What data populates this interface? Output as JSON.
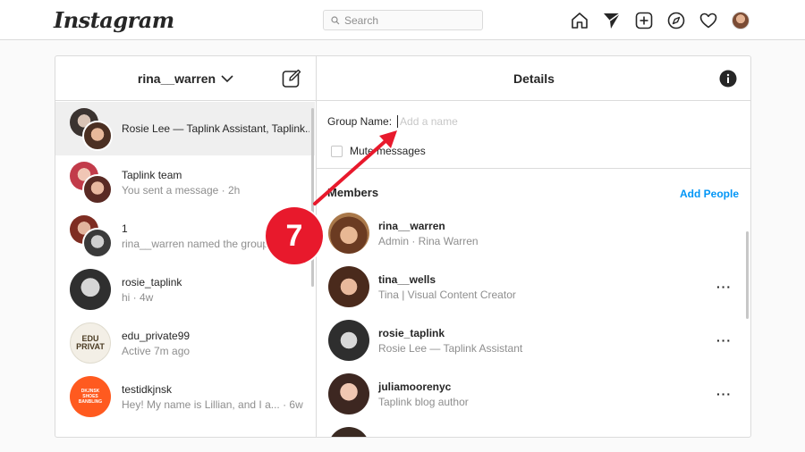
{
  "header": {
    "logo": "Instagram",
    "search_placeholder": "Search",
    "icons": [
      "home-icon",
      "direct-icon",
      "new-post-icon",
      "explore-icon",
      "activity-icon",
      "profile-avatar"
    ]
  },
  "inbox": {
    "username": "rina__warren",
    "conversations": [
      {
        "name": "Rosie Lee — Taplink Assistant, Taplink...",
        "sub": "",
        "group": true,
        "active": true
      },
      {
        "name": "Taplink team",
        "sub": "You sent a message · 2h",
        "group": true,
        "active": false
      },
      {
        "name": "1",
        "sub": "rina__warren named the group 1",
        "group": true,
        "active": false
      },
      {
        "name": "rosie_taplink",
        "sub": "hi · 4w",
        "group": false,
        "active": false
      },
      {
        "name": "edu_private99",
        "sub": "Active 7m ago",
        "group": false,
        "active": false
      },
      {
        "name": "testidkjnsk",
        "sub": "Hey! My name is Lillian, and I a...  · 6w",
        "group": false,
        "active": false
      }
    ],
    "edu_logo_text": "EDU PRIVAT",
    "testid_logo_text": "DKJNSK SHOES BANBLING"
  },
  "details": {
    "title": "Details",
    "group_name_label": "Group Name:",
    "group_name_placeholder": "Add a name",
    "mute_label": "Mute messages",
    "members_heading": "Members",
    "add_people": "Add People",
    "more_label": "···",
    "members": [
      {
        "name": "rina__warren",
        "sub": "Admin · Rina Warren",
        "more": false
      },
      {
        "name": "tina__wells",
        "sub": "Tina | Visual Content Creator",
        "more": true
      },
      {
        "name": "rosie_taplink",
        "sub": "Rosie Lee — Taplink Assistant",
        "more": true
      },
      {
        "name": "juliamoorenyc",
        "sub": "Taplink blog author",
        "more": true
      }
    ]
  },
  "annotation": {
    "step": "7",
    "color": "#e8192c"
  }
}
